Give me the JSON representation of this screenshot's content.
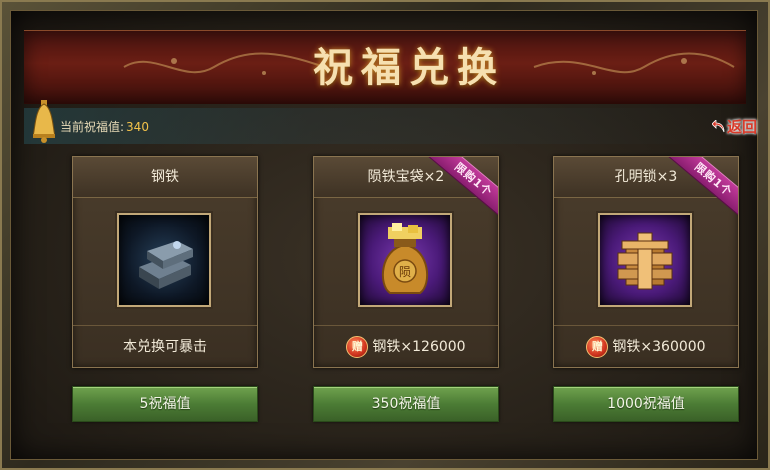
{
  "title": "祝福兑换",
  "blessing": {
    "label": "当前祝福值:",
    "value": "340"
  },
  "back_label": "返回",
  "colors": {
    "title": "#f6e0b0",
    "button": "#4c7c35",
    "ribbon": "#c23a9a",
    "value": "#f2c24a"
  },
  "cards": [
    {
      "name": "钢铁",
      "ribbon": "",
      "item_icon": "steel-ingot-icon",
      "footer_text": "本兑换可暴击",
      "gift_icon": "",
      "cost_label": "5祝福值"
    },
    {
      "name": "陨铁宝袋×2",
      "ribbon": "限购1个",
      "item_icon": "meteor-iron-bag-icon",
      "footer_gift": "赠",
      "footer_text": "钢铁×126000",
      "cost_label": "350祝福值"
    },
    {
      "name": "孔明锁×3",
      "ribbon": "限购1个",
      "item_icon": "kongming-lock-icon",
      "footer_gift": "赠",
      "footer_text": "钢铁×360000",
      "cost_label": "1000祝福值"
    }
  ]
}
